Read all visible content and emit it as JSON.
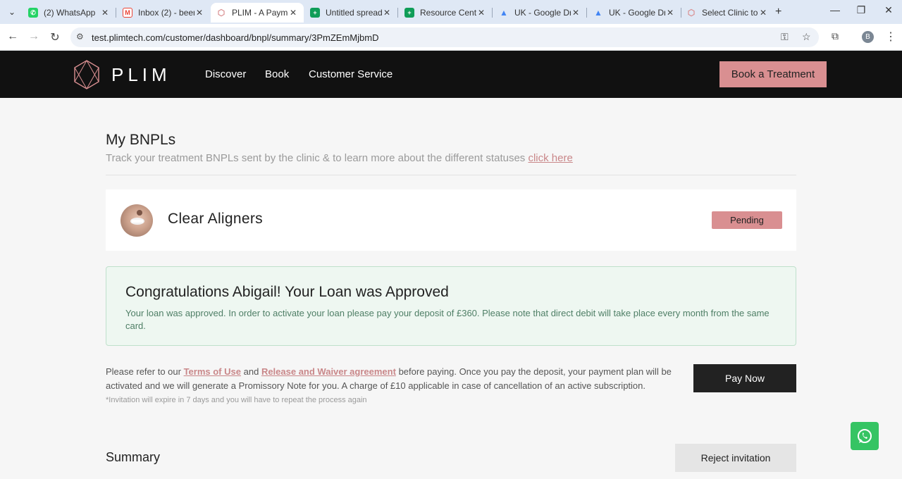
{
  "browser": {
    "tabs": [
      {
        "title": "(2) WhatsApp",
        "favicon": "whatsapp-icon",
        "color": "#25D366"
      },
      {
        "title": "Inbox (2) - been",
        "favicon": "gmail-icon",
        "color": "#EA4335"
      },
      {
        "title": "PLIM - A Payment",
        "favicon": "plim-icon",
        "color": "#d98f91",
        "active": true
      },
      {
        "title": "Untitled spreads",
        "favicon": "sheets-icon",
        "color": "#0F9D58"
      },
      {
        "title": "Resource Centre",
        "favicon": "sheets-icon",
        "color": "#0F9D58"
      },
      {
        "title": "UK - Google Dri",
        "favicon": "drive-icon",
        "color": "#4285F4"
      },
      {
        "title": "UK - Google Dri",
        "favicon": "drive-icon",
        "color": "#4285F4"
      },
      {
        "title": "Select Clinic to c",
        "favicon": "plim-icon",
        "color": "#d98f91"
      }
    ],
    "url": "test.plimtech.com/customer/dashboard/bnpl/summary/3PmZEmMjbmD",
    "profile_initial": "B"
  },
  "header": {
    "logo_text": "PLIM",
    "nav": [
      "Discover",
      "Book",
      "Customer Service"
    ],
    "cta": "Book a Treatment"
  },
  "page": {
    "title": "My BNPLs",
    "subtitle": "Track your treatment BNPLs sent by the clinic & to learn more about the different statuses",
    "subtitle_link": "click here"
  },
  "treatment": {
    "name": "Clear Aligners",
    "status": "Pending"
  },
  "approval": {
    "heading": "Congratulations Abigail! Your Loan was Approved",
    "message": "Your loan was approved. In order to activate your loan please pay your deposit of £360. Please note that direct debit will take place every month from the same card."
  },
  "payment": {
    "refer_prefix": "Please refer to our",
    "terms_link": "Terms of Use",
    "and_text": "and",
    "waiver_link": "Release and Waiver agreement",
    "refer_suffix": "before paying. Once you pay the deposit, your payment plan will be activated and we will generate a Promissory Note for you. A charge of £10 applicable in case of cancellation of an active subscription.",
    "note": "*Invitation will expire in 7 days and you will have to repeat the process again",
    "pay_button": "Pay Now"
  },
  "summary": {
    "title": "Summary",
    "reject_button": "Reject invitation"
  },
  "colors": {
    "brand_pink": "#d98f91",
    "header_bg": "#111111",
    "success_bg": "#eef7f1"
  }
}
